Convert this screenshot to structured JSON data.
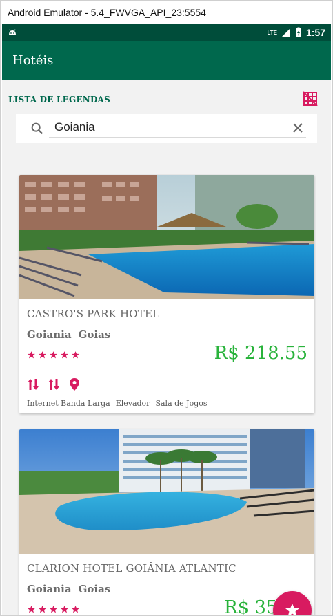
{
  "window": {
    "title": "Android Emulator - 5.4_FWVGA_API_23:5554"
  },
  "status_bar": {
    "network": "LTE",
    "time": "1:57"
  },
  "app_bar": {
    "title": "Hotéis"
  },
  "legend": {
    "title": "LISTA DE LEGENDAS",
    "icon": "grid-off-icon"
  },
  "search": {
    "value": "Goiania",
    "icon": "search-icon",
    "clear_icon": "close-icon"
  },
  "hotels": [
    {
      "name": "CASTRO'S PARK HOTEL",
      "city": "Goiania",
      "state": "Goias",
      "rating": 5,
      "price": "R$ 218.55",
      "amenity_icons": [
        "wifi-icon",
        "elevator-icon",
        "location-pin-icon"
      ],
      "amenities": [
        "Internet Banda Larga",
        "Elevador",
        "Sala de Jogos"
      ]
    },
    {
      "name": "CLARION HOTEL GOIÂNIA ATLANTIC",
      "city": "Goiania",
      "state": "Goias",
      "rating": 5,
      "price": "R$ 35",
      "amenity_icons": [
        "wifi-icon",
        "elevator-icon"
      ]
    }
  ],
  "fab": {
    "icon": "star-icon"
  },
  "colors": {
    "primary": "#00684d",
    "primary_dark": "#004d3a",
    "accent": "#d81b60",
    "price": "#29b33b"
  }
}
